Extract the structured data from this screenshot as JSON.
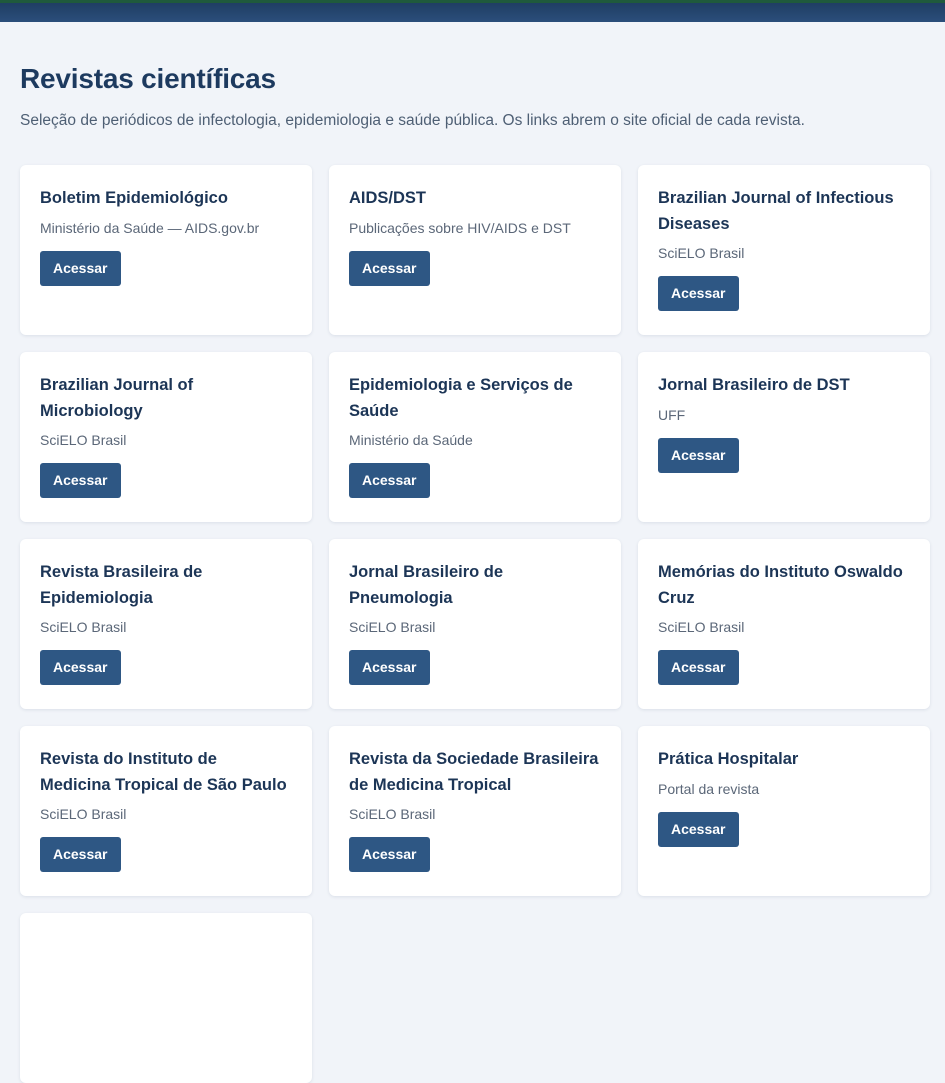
{
  "header": {
    "title": "Revistas científicas",
    "subtitle": "Seleção de periódicos de infectologia, epidemiologia e saúde pública. Os links abrem o site oficial de cada revista."
  },
  "cards": [
    {
      "title": "Boletim Epidemiológico",
      "source": "Ministério da Saúde — AIDS.gov.br",
      "button": "Acessar"
    },
    {
      "title": "AIDS/DST",
      "source": "Publicações sobre HIV/AIDS e DST",
      "button": "Acessar"
    },
    {
      "title": "Brazilian Journal of Infectious Diseases",
      "source": "SciELO Brasil",
      "button": "Acessar"
    },
    {
      "title": "Brazilian Journal of Microbiology",
      "source": "SciELO Brasil",
      "button": "Acessar"
    },
    {
      "title": "Epidemiologia e Serviços de Saúde",
      "source": "Ministério da Saúde",
      "button": "Acessar"
    },
    {
      "title": "Jornal Brasileiro de DST",
      "source": "UFF",
      "button": "Acessar"
    },
    {
      "title": "Revista Brasileira de Epidemiologia",
      "source": "SciELO Brasil",
      "button": "Acessar"
    },
    {
      "title": "Jornal Brasileiro de Pneumologia",
      "source": "SciELO Brasil",
      "button": "Acessar"
    },
    {
      "title": "Memórias do Instituto Oswaldo Cruz",
      "source": "SciELO Brasil",
      "button": "Acessar"
    },
    {
      "title": "Revista do Instituto de Medicina Tropical de São Paulo",
      "source": "SciELO Brasil",
      "button": "Acessar"
    },
    {
      "title": "Revista da Sociedade Brasileira de Medicina Tropical",
      "source": "SciELO Brasil",
      "button": "Acessar"
    },
    {
      "title": "Prática Hospitalar",
      "source": "Portal da revista",
      "button": "Acessar"
    },
    {
      "title": "",
      "source": "",
      "button": ""
    }
  ]
}
